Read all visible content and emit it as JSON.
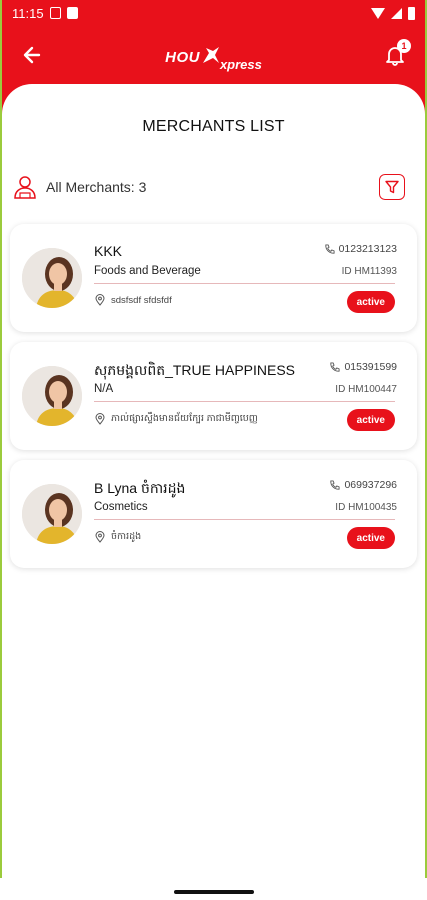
{
  "status_bar": {
    "time": "11:15"
  },
  "header": {
    "logo_main": "HOU",
    "logo_sub": "xpress",
    "notification_count": "1"
  },
  "page": {
    "title": "MERCHANTS LIST"
  },
  "summary": {
    "label": "All Merchants: 3"
  },
  "merchants": [
    {
      "name": "KKK",
      "category": "Foods and Beverage",
      "phone": "0123213123",
      "id": "ID HM11393",
      "address": "sdsfsdf sfdsfdf",
      "status": "active"
    },
    {
      "name": "សុភមង្គលពិត_TRUE HAPPINESS",
      "category": "N/A",
      "phone": "015391599",
      "id": "ID HM100447",
      "address": "ភាល់ផ្សារស្ទឹងមានជ័យក្បែរ ភាជាមីញ្ចបេញ្ញ",
      "status": "active"
    },
    {
      "name": "B Lyna ចំការដូង",
      "category": "Cosmetics",
      "phone": "069937296",
      "id": "ID HM100435",
      "address": "ចំការដូង",
      "status": "active"
    }
  ],
  "colors": {
    "brand": "#e8111b",
    "frame": "#9bcb3c"
  }
}
